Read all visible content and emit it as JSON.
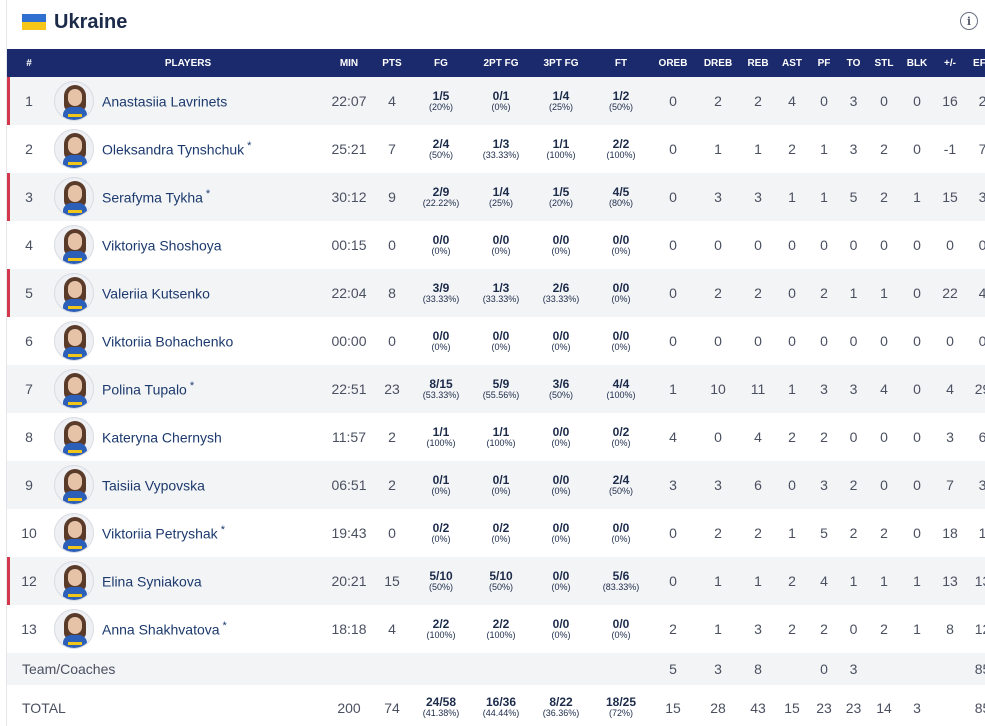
{
  "team": {
    "name": "Ukraine",
    "flag_colors": [
      "#2f6fd0",
      "#f5c518"
    ]
  },
  "info_icon": "info-circle-icon",
  "colors": {
    "header_bg": "#1a2a6c",
    "starter_mark": "#d4384c",
    "name": "#1c3a6e"
  },
  "columns": [
    "#",
    "PLAYERS",
    "MIN",
    "PTS",
    "FG",
    "2PT FG",
    "3PT FG",
    "FT",
    "OREB",
    "DREB",
    "REB",
    "AST",
    "PF",
    "TO",
    "STL",
    "BLK",
    "+/-",
    "EFF"
  ],
  "players": [
    {
      "no": "1",
      "name": "Anastasiia Lavrinets",
      "star": "",
      "mark": true,
      "min": "22:07",
      "pts": "4",
      "fg": "1/5",
      "fg_pct": "(20%)",
      "fg2": "0/1",
      "fg2_pct": "(0%)",
      "fg3": "1/4",
      "fg3_pct": "(25%)",
      "ft": "1/2",
      "ft_pct": "(50%)",
      "oreb": "0",
      "dreb": "2",
      "reb": "2",
      "ast": "4",
      "pf": "0",
      "to": "3",
      "stl": "0",
      "blk": "0",
      "pm": "16",
      "eff": "2"
    },
    {
      "no": "2",
      "name": "Oleksandra Tynshchuk",
      "star": "*",
      "mark": false,
      "min": "25:21",
      "pts": "7",
      "fg": "2/4",
      "fg_pct": "(50%)",
      "fg2": "1/3",
      "fg2_pct": "(33.33%)",
      "fg3": "1/1",
      "fg3_pct": "(100%)",
      "ft": "2/2",
      "ft_pct": "(100%)",
      "oreb": "0",
      "dreb": "1",
      "reb": "1",
      "ast": "2",
      "pf": "1",
      "to": "3",
      "stl": "2",
      "blk": "0",
      "pm": "-1",
      "eff": "7"
    },
    {
      "no": "3",
      "name": "Serafyma Tykha",
      "star": "*",
      "mark": true,
      "min": "30:12",
      "pts": "9",
      "fg": "2/9",
      "fg_pct": "(22.22%)",
      "fg2": "1/4",
      "fg2_pct": "(25%)",
      "fg3": "1/5",
      "fg3_pct": "(20%)",
      "ft": "4/5",
      "ft_pct": "(80%)",
      "oreb": "0",
      "dreb": "3",
      "reb": "3",
      "ast": "1",
      "pf": "1",
      "to": "5",
      "stl": "2",
      "blk": "1",
      "pm": "15",
      "eff": "3"
    },
    {
      "no": "4",
      "name": "Viktoriya Shoshoya",
      "star": "",
      "mark": false,
      "min": "00:15",
      "pts": "0",
      "fg": "0/0",
      "fg_pct": "(0%)",
      "fg2": "0/0",
      "fg2_pct": "(0%)",
      "fg3": "0/0",
      "fg3_pct": "(0%)",
      "ft": "0/0",
      "ft_pct": "(0%)",
      "oreb": "0",
      "dreb": "0",
      "reb": "0",
      "ast": "0",
      "pf": "0",
      "to": "0",
      "stl": "0",
      "blk": "0",
      "pm": "0",
      "eff": "0"
    },
    {
      "no": "5",
      "name": "Valeriia Kutsenko",
      "star": "",
      "mark": true,
      "min": "22:04",
      "pts": "8",
      "fg": "3/9",
      "fg_pct": "(33.33%)",
      "fg2": "1/3",
      "fg2_pct": "(33.33%)",
      "fg3": "2/6",
      "fg3_pct": "(33.33%)",
      "ft": "0/0",
      "ft_pct": "(0%)",
      "oreb": "0",
      "dreb": "2",
      "reb": "2",
      "ast": "0",
      "pf": "2",
      "to": "1",
      "stl": "1",
      "blk": "0",
      "pm": "22",
      "eff": "4"
    },
    {
      "no": "6",
      "name": "Viktoriia Bohachenko",
      "star": "",
      "mark": false,
      "min": "00:00",
      "pts": "0",
      "fg": "0/0",
      "fg_pct": "(0%)",
      "fg2": "0/0",
      "fg2_pct": "(0%)",
      "fg3": "0/0",
      "fg3_pct": "(0%)",
      "ft": "0/0",
      "ft_pct": "(0%)",
      "oreb": "0",
      "dreb": "0",
      "reb": "0",
      "ast": "0",
      "pf": "0",
      "to": "0",
      "stl": "0",
      "blk": "0",
      "pm": "0",
      "eff": "0"
    },
    {
      "no": "7",
      "name": "Polina Tupalo",
      "star": "*",
      "mark": false,
      "min": "22:51",
      "pts": "23",
      "fg": "8/15",
      "fg_pct": "(53.33%)",
      "fg2": "5/9",
      "fg2_pct": "(55.56%)",
      "fg3": "3/6",
      "fg3_pct": "(50%)",
      "ft": "4/4",
      "ft_pct": "(100%)",
      "oreb": "1",
      "dreb": "10",
      "reb": "11",
      "ast": "1",
      "pf": "3",
      "to": "3",
      "stl": "4",
      "blk": "0",
      "pm": "4",
      "eff": "29"
    },
    {
      "no": "8",
      "name": "Kateryna Chernysh",
      "star": "",
      "mark": false,
      "min": "11:57",
      "pts": "2",
      "fg": "1/1",
      "fg_pct": "(100%)",
      "fg2": "1/1",
      "fg2_pct": "(100%)",
      "fg3": "0/0",
      "fg3_pct": "(0%)",
      "ft": "0/2",
      "ft_pct": "(0%)",
      "oreb": "4",
      "dreb": "0",
      "reb": "4",
      "ast": "2",
      "pf": "2",
      "to": "0",
      "stl": "0",
      "blk": "0",
      "pm": "3",
      "eff": "6"
    },
    {
      "no": "9",
      "name": "Taisiia Vypovska",
      "star": "",
      "mark": false,
      "min": "06:51",
      "pts": "2",
      "fg": "0/1",
      "fg_pct": "(0%)",
      "fg2": "0/1",
      "fg2_pct": "(0%)",
      "fg3": "0/0",
      "fg3_pct": "(0%)",
      "ft": "2/4",
      "ft_pct": "(50%)",
      "oreb": "3",
      "dreb": "3",
      "reb": "6",
      "ast": "0",
      "pf": "3",
      "to": "2",
      "stl": "0",
      "blk": "0",
      "pm": "7",
      "eff": "3"
    },
    {
      "no": "10",
      "name": "Viktoriia Petryshak",
      "star": "*",
      "mark": false,
      "min": "19:43",
      "pts": "0",
      "fg": "0/2",
      "fg_pct": "(0%)",
      "fg2": "0/2",
      "fg2_pct": "(0%)",
      "fg3": "0/0",
      "fg3_pct": "(0%)",
      "ft": "0/0",
      "ft_pct": "(0%)",
      "oreb": "0",
      "dreb": "2",
      "reb": "2",
      "ast": "1",
      "pf": "5",
      "to": "2",
      "stl": "2",
      "blk": "0",
      "pm": "18",
      "eff": "1"
    },
    {
      "no": "12",
      "name": "Elina Syniakova",
      "star": "",
      "mark": true,
      "min": "20:21",
      "pts": "15",
      "fg": "5/10",
      "fg_pct": "(50%)",
      "fg2": "5/10",
      "fg2_pct": "(50%)",
      "fg3": "0/0",
      "fg3_pct": "(0%)",
      "ft": "5/6",
      "ft_pct": "(83.33%)",
      "oreb": "0",
      "dreb": "1",
      "reb": "1",
      "ast": "2",
      "pf": "4",
      "to": "1",
      "stl": "1",
      "blk": "1",
      "pm": "13",
      "eff": "13"
    },
    {
      "no": "13",
      "name": "Anna Shakhvatova",
      "star": "*",
      "mark": false,
      "min": "18:18",
      "pts": "4",
      "fg": "2/2",
      "fg_pct": "(100%)",
      "fg2": "2/2",
      "fg2_pct": "(100%)",
      "fg3": "0/0",
      "fg3_pct": "(0%)",
      "ft": "0/0",
      "ft_pct": "(0%)",
      "oreb": "2",
      "dreb": "1",
      "reb": "3",
      "ast": "2",
      "pf": "2",
      "to": "0",
      "stl": "2",
      "blk": "1",
      "pm": "8",
      "eff": "12"
    }
  ],
  "team_coaches": {
    "label": "Team/Coaches",
    "oreb": "5",
    "dreb": "3",
    "reb": "8",
    "pf": "0",
    "to": "3",
    "eff": "85"
  },
  "total": {
    "label": "TOTAL",
    "min": "200",
    "pts": "74",
    "fg": "24/58",
    "fg_pct": "(41.38%)",
    "fg2": "16/36",
    "fg2_pct": "(44.44%)",
    "fg3": "8/22",
    "fg3_pct": "(36.36%)",
    "ft": "18/25",
    "ft_pct": "(72%)",
    "oreb": "15",
    "dreb": "28",
    "reb": "43",
    "ast": "15",
    "pf": "23",
    "to": "23",
    "stl": "14",
    "blk": "3",
    "pm": "",
    "eff": "85"
  }
}
